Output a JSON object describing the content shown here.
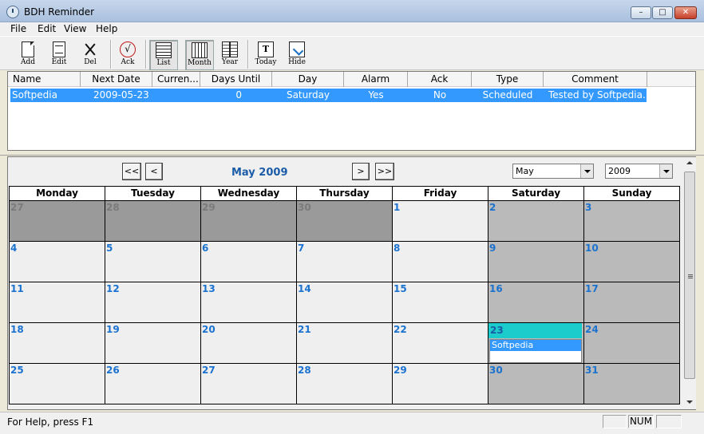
{
  "window": {
    "title": "BDH Reminder"
  },
  "menu": [
    "File",
    "Edit",
    "View",
    "Help"
  ],
  "toolbar": {
    "add": "Add",
    "edit": "Edit",
    "del": "Del",
    "ack": "Ack",
    "ack_glyph": "√",
    "list": "List",
    "month": "Month",
    "year": "Year",
    "today": "Today",
    "today_glyph": "T",
    "hide": "Hide"
  },
  "list": {
    "columns": [
      "Name",
      "Next Date",
      "Curren...",
      "Days Until",
      "Day",
      "Alarm",
      "Ack",
      "Type",
      "Comment"
    ],
    "rows": [
      {
        "name": "Softpedia",
        "next_date": "2009-05-23",
        "current": "",
        "days_until": "0",
        "day": "Saturday",
        "alarm": "Yes",
        "ack": "No",
        "type": "Scheduled",
        "comment": "Tested by Softpedia...."
      }
    ]
  },
  "calendar": {
    "nav": {
      "first": "<<",
      "prev": "<",
      "next": ">",
      "last": ">>"
    },
    "title": "May 2009",
    "month_select": "May",
    "year_select": "2009",
    "weekdays": [
      "Monday",
      "Tuesday",
      "Wednesday",
      "Thursday",
      "Friday",
      "Saturday",
      "Sunday"
    ],
    "weeks": [
      [
        "27",
        "28",
        "29",
        "30",
        "1",
        "2",
        "3"
      ],
      [
        "4",
        "5",
        "6",
        "7",
        "8",
        "9",
        "10"
      ],
      [
        "11",
        "12",
        "13",
        "14",
        "15",
        "16",
        "17"
      ],
      [
        "18",
        "19",
        "20",
        "21",
        "22",
        "23",
        "24"
      ],
      [
        "25",
        "26",
        "27",
        "28",
        "29",
        "30",
        "31"
      ]
    ],
    "today_event": "Softpedia"
  },
  "status": {
    "help": "For Help, press F1",
    "num": "NUM"
  },
  "colors": {
    "selection": "#3399ff",
    "day_number": "#1b72cf",
    "today_header": "#1ccbcb",
    "weekend": "#bababa",
    "outside_month": "#9a9a9a"
  }
}
